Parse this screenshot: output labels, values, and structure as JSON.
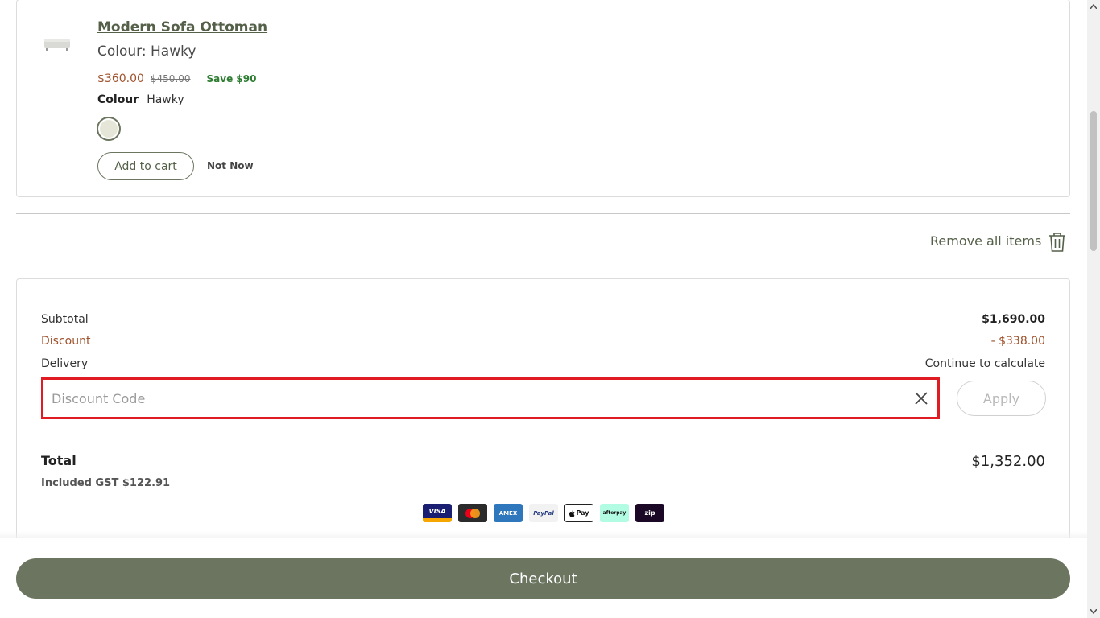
{
  "product": {
    "title": "Modern Sofa Ottoman",
    "colour_line": "Colour: Hawky",
    "price_now": "$360.00",
    "price_old": "$450.00",
    "save": "Save $90",
    "colour_key": "Colour",
    "colour_value": "Hawky",
    "swatch_color": "#e6e6d8",
    "add_to_cart": "Add to cart",
    "not_now": "Not Now"
  },
  "remove_all": {
    "label": "Remove all items",
    "icon": "trash-icon"
  },
  "summary": {
    "subtotal_label": "Subtotal",
    "subtotal_value": "$1,690.00",
    "discount_label": "Discount",
    "discount_value": "- $338.00",
    "delivery_label": "Delivery",
    "delivery_value": "Continue to calculate",
    "discount_placeholder": "Discount Code",
    "discount_value_input": "",
    "apply_label": "Apply",
    "total_label": "Total",
    "total_value": "$1,352.00",
    "gst": "Included GST $122.91"
  },
  "payment_methods": {
    "visa": "VISA",
    "amex": "AMEX",
    "paypal": "PayPal",
    "apple_pay": "Pay",
    "afterpay": "afterpay",
    "zip": "zip"
  },
  "checkout_label": "Checkout",
  "colors": {
    "brand": "#6b7560",
    "discount": "#a0522d",
    "highlight": "#e01b24"
  }
}
